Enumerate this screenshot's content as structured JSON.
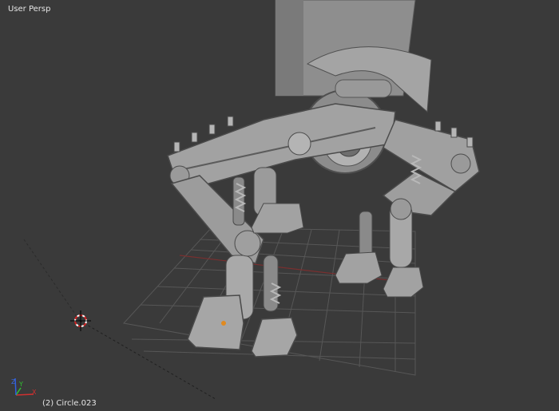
{
  "viewport": {
    "view_label": "User Persp",
    "object_label": "(2) Circle.023"
  },
  "axes": {
    "x_label": "X",
    "y_label": "Y",
    "z_label": "Z",
    "x_color": "#d03030",
    "y_color": "#30c030",
    "z_color": "#3060e0"
  },
  "colors": {
    "background": "#3a3a3a",
    "grid": "#555555",
    "model": "#a8a8a8",
    "model_shadow": "#6e6e6e",
    "model_dark": "#4a4a4a"
  }
}
